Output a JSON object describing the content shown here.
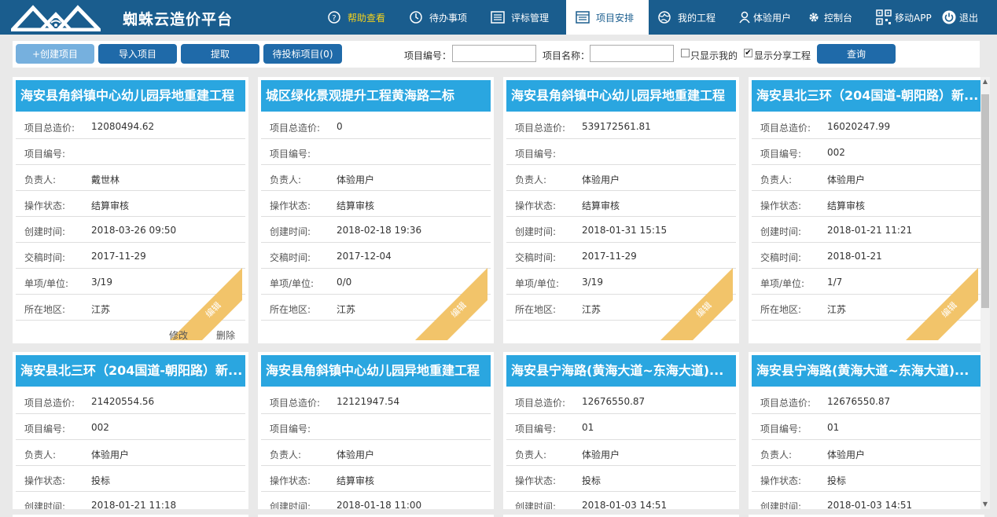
{
  "header": {
    "brand": "蜘蛛云造价平台",
    "nav": [
      {
        "label": "帮助查看",
        "icon": "help-circle-icon"
      },
      {
        "label": "待办事项",
        "icon": "clock-icon"
      },
      {
        "label": "评标管理",
        "icon": "list-doc-icon"
      },
      {
        "label": "项目安排",
        "icon": "calendar-list-icon"
      },
      {
        "label": "我的工程",
        "icon": "globe-icon"
      },
      {
        "label": "体验用户",
        "icon": "user-icon"
      },
      {
        "label": "控制台",
        "icon": "gear-icon"
      },
      {
        "label": "移动APP",
        "icon": "qrcode-icon"
      },
      {
        "label": "退出",
        "icon": "power-icon"
      }
    ]
  },
  "toolbar": {
    "create": "+创建项目",
    "import": "导入项目",
    "extract": "提取",
    "pending": "待投标项目(0)",
    "project_no_label": "项目编号：",
    "project_no_value": "",
    "project_name_label": "项目名称：",
    "project_name_value": "",
    "only_mine_label": "只显示我的",
    "only_mine_checked": false,
    "show_shared_label": "显示分享工程",
    "show_shared_checked": true,
    "query": "查询"
  },
  "field_labels": [
    "项目总造价:",
    "项目编号:",
    "负责人:",
    "操作状态:",
    "创建时间:",
    "交稿时间:",
    "单项/单位:",
    "所在地区:"
  ],
  "ribbon_label": "编辑",
  "card_actions": {
    "edit": "修改",
    "delete": "删除"
  },
  "cards": [
    {
      "title": "海安县角斜镇中心幼儿园异地重建工程",
      "values": [
        "12080494.62",
        "",
        "戴世林",
        "结算审核",
        "2018-03-26 09:50",
        "2017-11-29",
        "3/19",
        "江苏"
      ]
    },
    {
      "title": "城区绿化景观提升工程黄海路二标",
      "values": [
        "0",
        "",
        "体验用户",
        "结算审核",
        "2018-02-18 19:36",
        "2017-12-04",
        "0/0",
        "江苏"
      ]
    },
    {
      "title": "海安县角斜镇中心幼儿园异地重建工程",
      "values": [
        "539172561.81",
        "",
        "体验用户",
        "结算审核",
        "2018-01-31 15:15",
        "2017-11-29",
        "3/19",
        "江苏"
      ]
    },
    {
      "title": "海安县北三环（204国道-朝阳路）新...",
      "values": [
        "16020247.99",
        "002",
        "体验用户",
        "结算审核",
        "2018-01-21 11:21",
        "2018-01-21",
        "1/7",
        "江苏"
      ]
    },
    {
      "title": "海安县北三环（204国道-朝阳路）新...",
      "values": [
        "21420554.56",
        "002",
        "体验用户",
        "投标",
        "2018-01-21 11:18"
      ]
    },
    {
      "title": "海安县角斜镇中心幼儿园异地重建工程",
      "values": [
        "12121947.54",
        "",
        "体验用户",
        "结算审核",
        "2018-01-18 11:00"
      ]
    },
    {
      "title": "海安县宁海路(黄海大道~东海大道)...",
      "values": [
        "12676550.87",
        "01",
        "体验用户",
        "投标",
        "2018-01-03 14:51"
      ]
    },
    {
      "title": "海安县宁海路(黄海大道~东海大道)...",
      "values": [
        "12676550.87",
        "01",
        "体验用户",
        "投标",
        "2018-01-03 14:51"
      ]
    }
  ]
}
